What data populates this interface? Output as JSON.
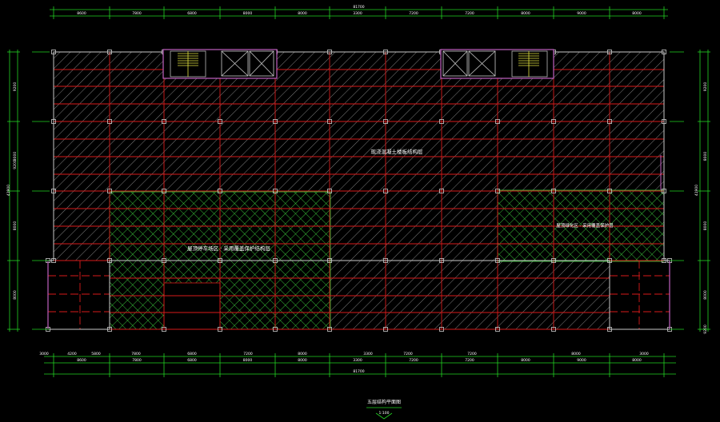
{
  "drawing": {
    "title": "五层结构平面图",
    "scale": "1:100",
    "total_dimension": "81700",
    "area_labels": {
      "main_slab": "现浇混凝土楼板结构层",
      "hatched_left": "屋顶停车场区 · 采用覆盖保护结构层",
      "hatched_right": "屋顶绿化区 · 采用覆盖保护层"
    },
    "dims_top": [
      "8600",
      "7800",
      "6800",
      "8000",
      "8000",
      "3300",
      "7200",
      "7200",
      "8000",
      "9000",
      "8000"
    ],
    "dims_bottom": [
      "8600",
      "7800",
      "6800",
      "8000",
      "8000",
      "3300",
      "7200",
      "7200",
      "8000",
      "9000",
      "8000"
    ],
    "dims_bottom_offsets": [
      "3000",
      "4200",
      "5800",
      "7800",
      "6800",
      "7200",
      "8000",
      "3300",
      "7200",
      "7200",
      "8000",
      "3000"
    ],
    "dims_left": [
      "9200",
      "8000",
      "8000",
      "8000",
      "9200"
    ],
    "dims_left_total": "41900",
    "dims_right": [
      "9200",
      "8000",
      "8000",
      "8000",
      "9200"
    ],
    "dims_right_total": "41900"
  },
  "colors": {
    "background": "#000000",
    "dimension_lines": "#22d322",
    "grid_red": "#d91a1a",
    "hatch_gray": "#9a9a9a",
    "hatch_green": "#3ecf3e",
    "wall_magenta": "#c060c0",
    "text_white": "#ffffff",
    "stair_yellow": "#e0e040"
  }
}
